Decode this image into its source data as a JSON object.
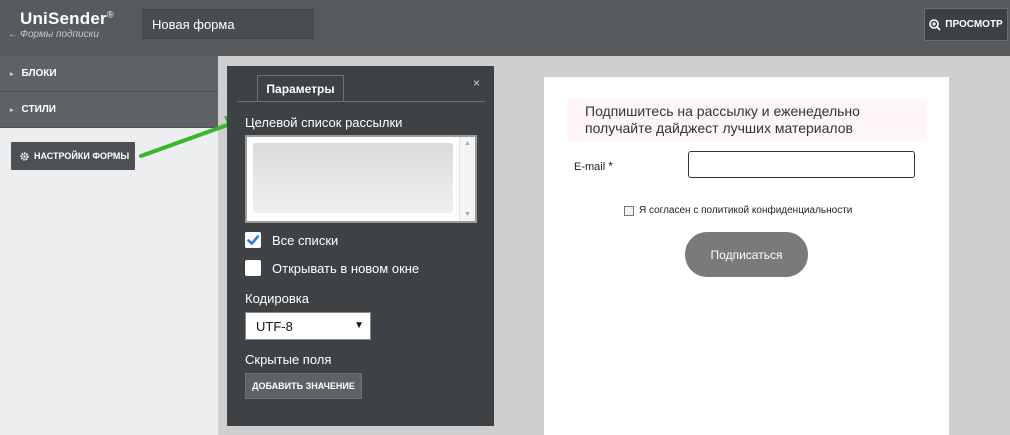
{
  "header": {
    "logo_name": "UniSender",
    "logo_reg": "®",
    "logo_sub": "Формы подписки",
    "form_name": "Новая форма",
    "preview_label": "ПРОСМОТР"
  },
  "sidebar": {
    "sections": [
      {
        "label": "БЛОКИ"
      },
      {
        "label": "СТИЛИ"
      }
    ],
    "settings_button": "НАСТРОЙКИ ФОРМЫ"
  },
  "panel": {
    "tab_label": "Параметры",
    "close_glyph": "×",
    "target_list_label": "Целевой список рассылки",
    "all_lists_label": "Все списки",
    "all_lists_checked": true,
    "new_window_label": "Открывать в новом окне",
    "new_window_checked": false,
    "encoding_label": "Кодировка",
    "encoding_value": "UTF-8",
    "hidden_fields_label": "Скрытые поля",
    "add_value_button": "ДОБАВИТЬ ЗНАЧЕНИЕ"
  },
  "form_preview": {
    "promo_text": "Подпишитесь на рассылку и еженедельно получайте дайджест лучших материалов",
    "email_label": "E-mail",
    "required_mark": "*",
    "consent_label": "Я согласен с политикой конфиденциальности",
    "subscribe_button": "Подписаться"
  },
  "colors": {
    "topbar": "#575b5e",
    "panel": "#3e4245",
    "checkbox_accent": "#2b7fd4",
    "annotation_arrow": "#35b82a",
    "subscribe_button": "#7a7a7a"
  },
  "icons": {
    "preview": "zoom-in-icon",
    "settings": "gear-icon",
    "checked": "checkmark-icon",
    "back": "arrow-left-icon"
  }
}
